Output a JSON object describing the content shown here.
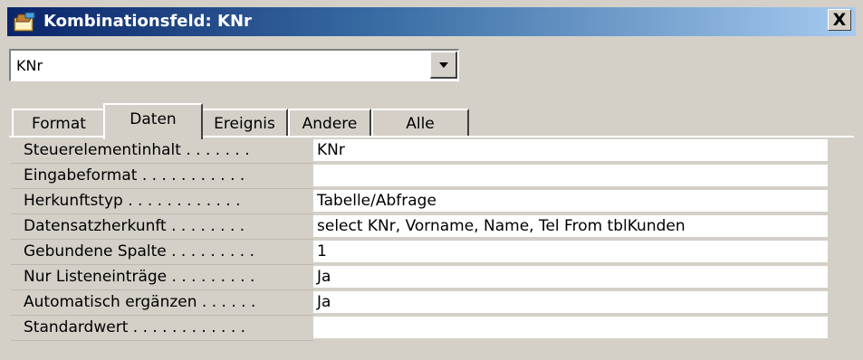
{
  "window": {
    "title": "Kombinationsfeld: KNr",
    "close_symbol": "X",
    "icon": "properties-icon"
  },
  "object_selector": {
    "value": "KNr"
  },
  "tabs": [
    {
      "label": "Format",
      "active": false
    },
    {
      "label": "Daten",
      "active": true
    },
    {
      "label": "Ereignis",
      "active": false
    },
    {
      "label": "Andere",
      "active": false
    },
    {
      "label": "Alle",
      "active": false
    }
  ],
  "properties": [
    {
      "label": "Steuerelementinhalt",
      "dots": " . . . . . . .",
      "value": "KNr"
    },
    {
      "label": "Eingabeformat",
      "dots": " . . . . . . . . . . .",
      "value": ""
    },
    {
      "label": "Herkunftstyp",
      "dots": " . . . . . . . . . . . .",
      "value": "Tabelle/Abfrage"
    },
    {
      "label": "Datensatzherkunft",
      "dots": " . . . . . . . .",
      "value": "select KNr, Vorname, Name, Tel From tblKunden"
    },
    {
      "label": "Gebundene Spalte",
      "dots": " . . . . . . . . .",
      "value": "1"
    },
    {
      "label": "Nur Listeneinträge",
      "dots": " . . . . . . . . .",
      "value": "Ja"
    },
    {
      "label": "Automatisch ergänzen",
      "dots": " . . . . . .",
      "value": "Ja"
    },
    {
      "label": "Standardwert",
      "dots": " . . . . . . . . . . . .",
      "value": ""
    }
  ]
}
